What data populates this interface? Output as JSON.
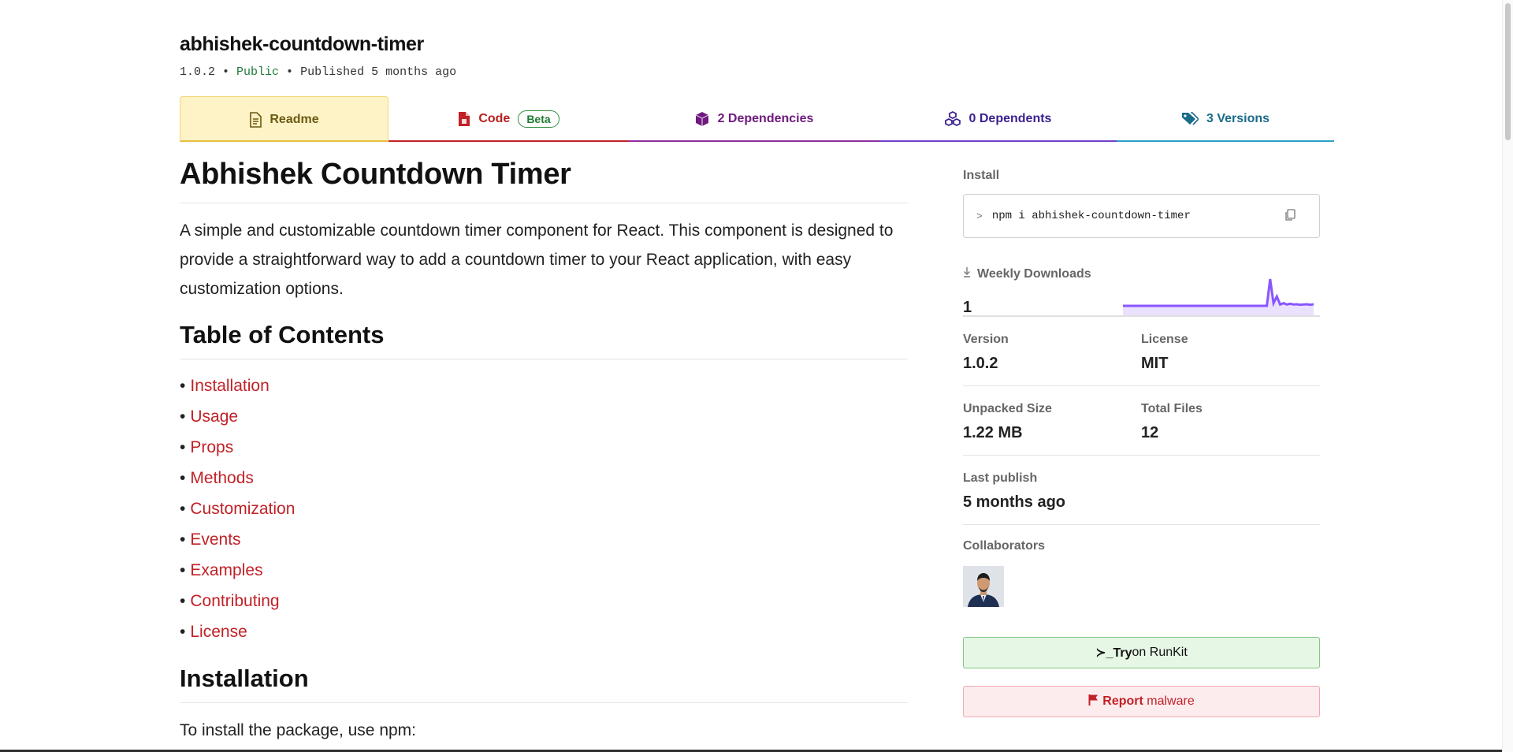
{
  "package": {
    "name": "abhishek-countdown-timer",
    "version": "1.0.2",
    "sep1": " • ",
    "visibility": "Public",
    "sep2": " • ",
    "published": "Published 5 months ago"
  },
  "tabs": {
    "readme": "Readme",
    "code": "Code",
    "code_badge": "Beta",
    "dependencies": "2 Dependencies",
    "dependents": "0 Dependents",
    "versions": "3 Versions"
  },
  "readme": {
    "title": "Abhishek Countdown Timer",
    "intro": "A simple and customizable countdown timer component for React. This component is designed to provide a straightforward way to add a countdown timer to your React application, with easy customization options.",
    "toc_heading": "Table of Contents",
    "toc": [
      "Installation",
      "Usage",
      "Props",
      "Methods",
      "Customization",
      "Events",
      "Examples",
      "Contributing",
      "License"
    ],
    "install_heading": "Installation",
    "install_text": "To install the package, use npm:"
  },
  "sidebar": {
    "install_label": "Install",
    "install_prompt": ">",
    "install_command": "npm i abhishek-countdown-timer",
    "weekly_downloads_label": "Weekly Downloads",
    "weekly_downloads_value": "1",
    "weekly_downloads_series": [
      0,
      0,
      0,
      0,
      0,
      0,
      0,
      0,
      0,
      0,
      0,
      0,
      0,
      0,
      0,
      0,
      0,
      0,
      0,
      0,
      0,
      0,
      0,
      0,
      0,
      0,
      0,
      0,
      0,
      0,
      0,
      0,
      0,
      0,
      0,
      0,
      0,
      0,
      0,
      0,
      0,
      0,
      0,
      0,
      1,
      0.1,
      0.35,
      0.05,
      0.1,
      0.05,
      0.08,
      0.05,
      0.06,
      0.04,
      0.05,
      0.06,
      0.04,
      0.06
    ],
    "version_label": "Version",
    "version_value": "1.0.2",
    "license_label": "License",
    "license_value": "MIT",
    "unpacked_label": "Unpacked Size",
    "unpacked_value": "1.22 MB",
    "files_label": "Total Files",
    "files_value": "12",
    "last_publish_label": "Last publish",
    "last_publish_value": "5 months ago",
    "collaborators_label": "Collaborators",
    "runkit_prefix": "≻_Try",
    "runkit_suffix": " on RunKit",
    "report_prefix": "Report",
    "report_suffix": " malware"
  },
  "colors": {
    "accent_red": "#c12127",
    "sparkline": "#8956ff"
  }
}
